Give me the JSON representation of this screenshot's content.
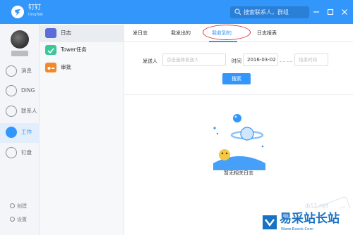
{
  "app": {
    "name": "钉钉",
    "subtitle": "DingTalk"
  },
  "search": {
    "placeholder": "搜索联系人，群组"
  },
  "nav": {
    "items": [
      {
        "label": "消息",
        "icon": "chat-icon"
      },
      {
        "label": "DING",
        "icon": "ding-icon"
      },
      {
        "label": "联系人",
        "icon": "contacts-icon"
      },
      {
        "label": "工作",
        "icon": "work-icon",
        "active": true
      },
      {
        "label": "钉盘",
        "icon": "cloud-disk-icon"
      }
    ],
    "create_label": "创建",
    "settings_label": "设置"
  },
  "submenu": {
    "items": [
      {
        "label": "日志",
        "icon": "journal-icon",
        "color": "#5b6dd9",
        "active": true
      },
      {
        "label": "Tower任务",
        "icon": "tower-check-icon",
        "color": "#3cc79a"
      },
      {
        "label": "审批",
        "icon": "approval-icon",
        "color": "#f0892b"
      }
    ]
  },
  "tabs": [
    {
      "label": "发日志"
    },
    {
      "label": "我发出的"
    },
    {
      "label": "我收到的",
      "active": true
    },
    {
      "label": "日志报表"
    }
  ],
  "filter": {
    "sender_label": "发送人",
    "sender_placeholder": "点击选择发送人",
    "time_label": "时间",
    "start_date": "2016-03-02",
    "end_placeholder": "结束时间",
    "search_button": "搜索"
  },
  "empty_state": {
    "text": "暂无相关日志"
  },
  "watermark": {
    "title": "易采站长站",
    "subtitle": "Www.Easck.Com",
    "url": "jb51.net"
  },
  "colors": {
    "accent": "#3296fa",
    "annotation": "#d9383a"
  }
}
